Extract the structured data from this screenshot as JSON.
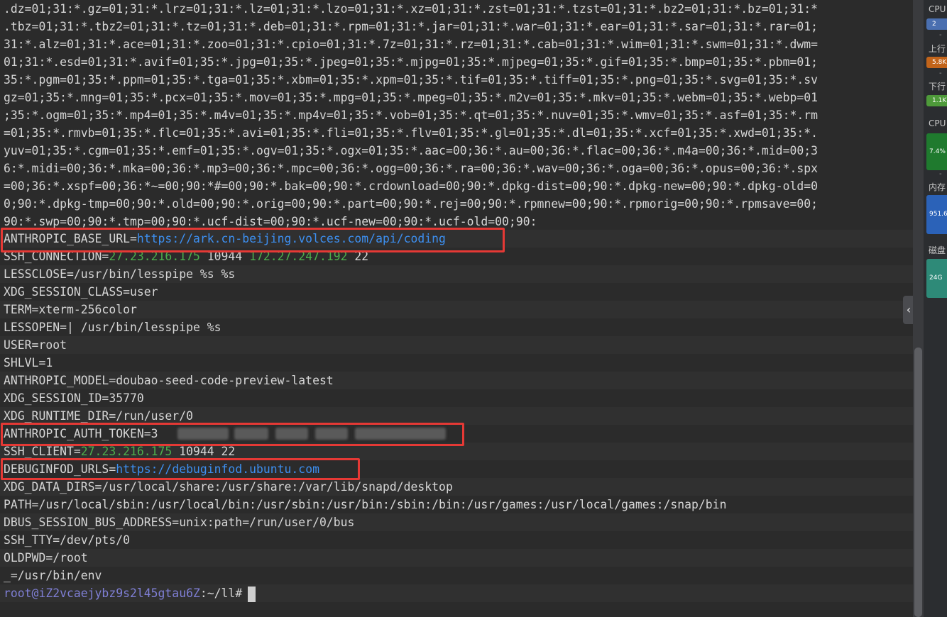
{
  "terminal": {
    "wrapped_lines": [
      ".dz=01;31:*.gz=01;31:*.lrz=01;31:*.lz=01;31:*.lzo=01;31:*.xz=01;31:*.zst=01;31:*.tzst=01;31:*.bz2=01;31:*.bz=01;31:*",
      ".tbz=01;31:*.tbz2=01;31:*.tz=01;31:*.deb=01;31:*.rpm=01;31:*.jar=01;31:*.war=01;31:*.ear=01;31:*.sar=01;31:*.rar=01;",
      "31:*.alz=01;31:*.ace=01;31:*.zoo=01;31:*.cpio=01;31:*.7z=01;31:*.rz=01;31:*.cab=01;31:*.wim=01;31:*.swm=01;31:*.dwm=",
      "01;31:*.esd=01;31:*.avif=01;35:*.jpg=01;35:*.jpeg=01;35:*.mjpg=01;35:*.mjpeg=01;35:*.gif=01;35:*.bmp=01;35:*.pbm=01;",
      "35:*.pgm=01;35:*.ppm=01;35:*.tga=01;35:*.xbm=01;35:*.xpm=01;35:*.tif=01;35:*.tiff=01;35:*.png=01;35:*.svg=01;35:*.sv",
      "gz=01;35:*.mng=01;35:*.pcx=01;35:*.mov=01;35:*.mpg=01;35:*.mpeg=01;35:*.m2v=01;35:*.mkv=01;35:*.webm=01;35:*.webp=01",
      ";35:*.ogm=01;35:*.mp4=01;35:*.m4v=01;35:*.mp4v=01;35:*.vob=01;35:*.qt=01;35:*.nuv=01;35:*.wmv=01;35:*.asf=01;35:*.rm",
      "=01;35:*.rmvb=01;35:*.flc=01;35:*.avi=01;35:*.fli=01;35:*.flv=01;35:*.gl=01;35:*.dl=01;35:*.xcf=01;35:*.xwd=01;35:*.",
      "yuv=01;35:*.cgm=01;35:*.emf=01;35:*.ogv=01;35:*.ogx=01;35:*.aac=00;36:*.au=00;36:*.flac=00;36:*.m4a=00;36:*.mid=00;3",
      "6:*.midi=00;36:*.mka=00;36:*.mp3=00;36:*.mpc=00;36:*.ogg=00;36:*.ra=00;36:*.wav=00;36:*.oga=00;36:*.opus=00;36:*.spx",
      "=00;36:*.xspf=00;36:*~=00;90:*#=00;90:*.bak=00;90:*.crdownload=00;90:*.dpkg-dist=00;90:*.dpkg-new=00;90:*.dpkg-old=0",
      "0;90:*.dpkg-tmp=00;90:*.old=00;90:*.orig=00;90:*.part=00;90:*.rej=00;90:*.rpmnew=00;90:*.rpmorig=00;90:*.rpmsave=00;",
      "90:*.swp=00;90:*.tmp=00;90:*.ucf-dist=00;90:*.ucf-new=00;90:*.ucf-old=00;90:"
    ],
    "env": {
      "base_url_key": "ANTHROPIC_BASE_URL=",
      "base_url_val": "https://ark.cn-beijing.volces.com/api/coding",
      "ssh_conn_key": "SSH_CONNECTION=",
      "ssh_conn_ip1": "27.23.216.175",
      "ssh_conn_port1": " 10944 ",
      "ssh_conn_ip2": "172.27.247.192",
      "ssh_conn_port2": " 22",
      "lessclose": "LESSCLOSE=/usr/bin/lesspipe %s %s",
      "xdg_session_class": "XDG_SESSION_CLASS=user",
      "term": "TERM=xterm-256color",
      "lessopen": "LESSOPEN=| /usr/bin/lesspipe %s",
      "user": "USER=root",
      "shlvl": "SHLVL=1",
      "model": "ANTHROPIC_MODEL=doubao-seed-code-preview-latest",
      "xdg_session_id": "XDG_SESSION_ID=35770",
      "xdg_runtime_dir": "XDG_RUNTIME_DIR=/run/user/0",
      "auth_token_key": "ANTHROPIC_AUTH_TOKEN=",
      "auth_token_visible": "3",
      "ssh_client_key": "SSH_CLIENT=",
      "ssh_client_ip": "27.23.216.175",
      "ssh_client_rest": " 10944 22",
      "debuginfod_key": "DEBUGINFOD_URLS=",
      "debuginfod_val": "https://debuginfod.ubuntu.com",
      "xdg_data_dirs": "XDG_DATA_DIRS=/usr/local/share:/usr/share:/var/lib/snapd/desktop",
      "path": "PATH=/usr/local/sbin:/usr/local/bin:/usr/sbin:/usr/bin:/sbin:/bin:/usr/games:/usr/local/games:/snap/bin",
      "dbus": "DBUS_SESSION_BUS_ADDRESS=unix:path=/run/user/0/bus",
      "ssh_tty": "SSH_TTY=/dev/pts/0",
      "oldpwd": "OLDPWD=/root",
      "underscore": "_=/usr/bin/env"
    },
    "prompt": {
      "user_host": "root@iZ2vcaejybz9s2l45gtau6Z",
      "path": ":~/ll#"
    }
  },
  "collapse_handle": {
    "glyph": "‹"
  },
  "monitor": {
    "cpu_label": "CPU",
    "cpu_value": "2",
    "upload_label": "上行",
    "upload_value": "5.8K",
    "download_label": "下行",
    "download_value": "1.1K",
    "cpu_usage_label": "CPU",
    "cpu_usage_value": "7.4%",
    "memory_label": "内存",
    "memory_value": "951.6",
    "disk_label": "磁盘",
    "disk_value": "24G",
    "dash": "-"
  },
  "colors": {
    "terminal_bg": "#2b2b2b",
    "text": "#d6d6d6",
    "url": "#3d8ff0",
    "ip": "#4cae4c",
    "highlight": "#e53935",
    "prompt_user": "#7f7fd5"
  }
}
